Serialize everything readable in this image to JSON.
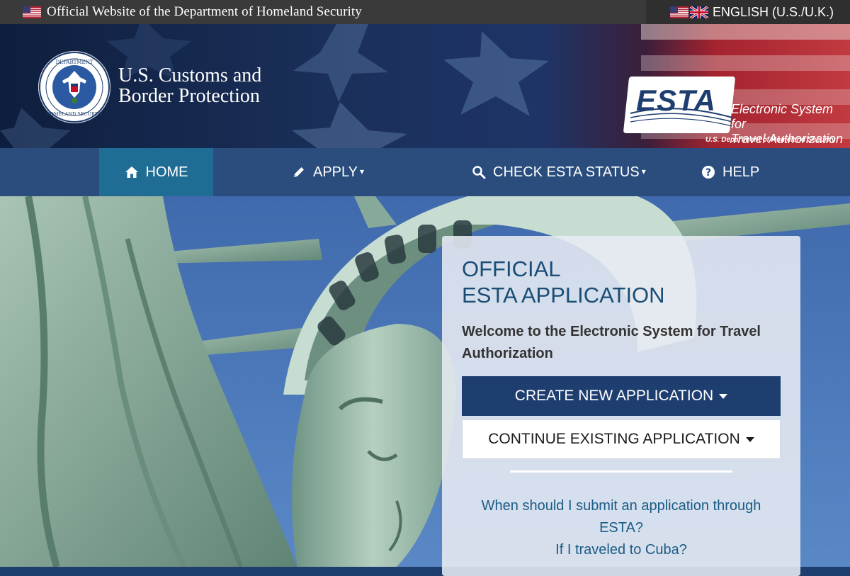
{
  "topbar": {
    "official_text": "Official Website of the Department of Homeland Security",
    "language_label": "ENGLISH (U.S./U.K.)"
  },
  "header": {
    "agency_line1": "U.S. Customs and",
    "agency_line2": "Border Protection",
    "esta_logo": {
      "wordmark": "ESTA",
      "tagline_line1": "Electronic System for",
      "tagline_line2": "Travel Authorization",
      "department": "U.S. Department of Homeland Security"
    }
  },
  "nav": {
    "items": [
      {
        "label": "HOME",
        "icon": "home-icon",
        "active": true
      },
      {
        "label": "APPLY",
        "icon": "pencil-icon",
        "dropdown": true
      },
      {
        "label": "CHECK ESTA STATUS",
        "icon": "search-icon",
        "dropdown": true
      },
      {
        "label": "HELP",
        "icon": "question-circle-icon"
      }
    ]
  },
  "panel": {
    "title_line1": "OFFICIAL",
    "title_line2": "ESTA APPLICATION",
    "welcome": "Welcome to the Electronic System for Travel Authorization",
    "create_button": "CREATE NEW APPLICATION",
    "continue_button": "CONTINUE EXISTING APPLICATION",
    "faq": [
      "When should I submit an application through ESTA?",
      "If I traveled to Cuba?"
    ]
  },
  "colors": {
    "nav_bg": "#2a4d7e",
    "nav_active": "#1f6d95",
    "primary": "#1f3e70",
    "title": "#1a4d75",
    "link": "#1a5c86"
  }
}
